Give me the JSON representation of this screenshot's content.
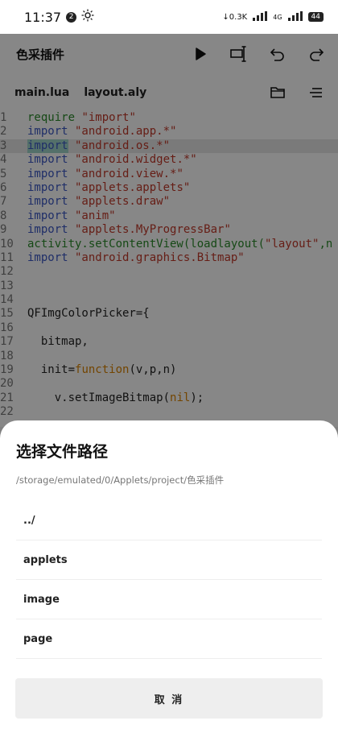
{
  "status_bar": {
    "time": "11:37",
    "notif_count": "2",
    "net_speed": "0.3K",
    "net_type": "4G",
    "battery": "44"
  },
  "toolbar": {
    "title": "色采插件"
  },
  "tabs": [
    "main.lua",
    "layout.aly"
  ],
  "editor": {
    "line_numbers": [
      "1",
      "2",
      "3",
      "4",
      "5",
      "6",
      "7",
      "8",
      "9",
      "10",
      "11",
      "12",
      "13",
      "14",
      "15",
      "16",
      "17",
      "18",
      "19",
      "20",
      "21",
      "22"
    ],
    "code": {
      "l1a": "require",
      "l1b": " \"import\"",
      "l2a": "import",
      "l2b": " \"android.app.*\"",
      "l3a": "import",
      "l3b": " \"android.os.*\"",
      "l4a": "import",
      "l4b": " \"android.widget.*\"",
      "l5a": "import",
      "l5b": " \"android.view.*\"",
      "l6a": "import",
      "l6b": " \"applets.applets\"",
      "l7a": "import",
      "l7b": " \"applets.draw\"",
      "l8a": "import",
      "l8b": " \"anim\"",
      "l9a": "import",
      "l9b": " \"applets.MyProgressBar\"",
      "l10a": "activity.setContentView(loadlayout(",
      "l10b": "\"layout\"",
      "l10c": ",n",
      "l11a": "import",
      "l11b": " \"android.graphics.Bitmap\"",
      "l15": "QFImgColorPicker={",
      "l17": "  bitmap,",
      "l19a": "  init=",
      "l19b": "function",
      "l19c": "(v,p,n)",
      "l21a": "    v.setImageBitmap(",
      "l21b": "nil",
      "l21c": ");"
    }
  },
  "sheet": {
    "title": "选择文件路径",
    "path": "/storage/emulated/0/Applets/project/色采插件",
    "items": [
      "../",
      "applets",
      "image",
      "page"
    ],
    "cancel": "取 消"
  }
}
